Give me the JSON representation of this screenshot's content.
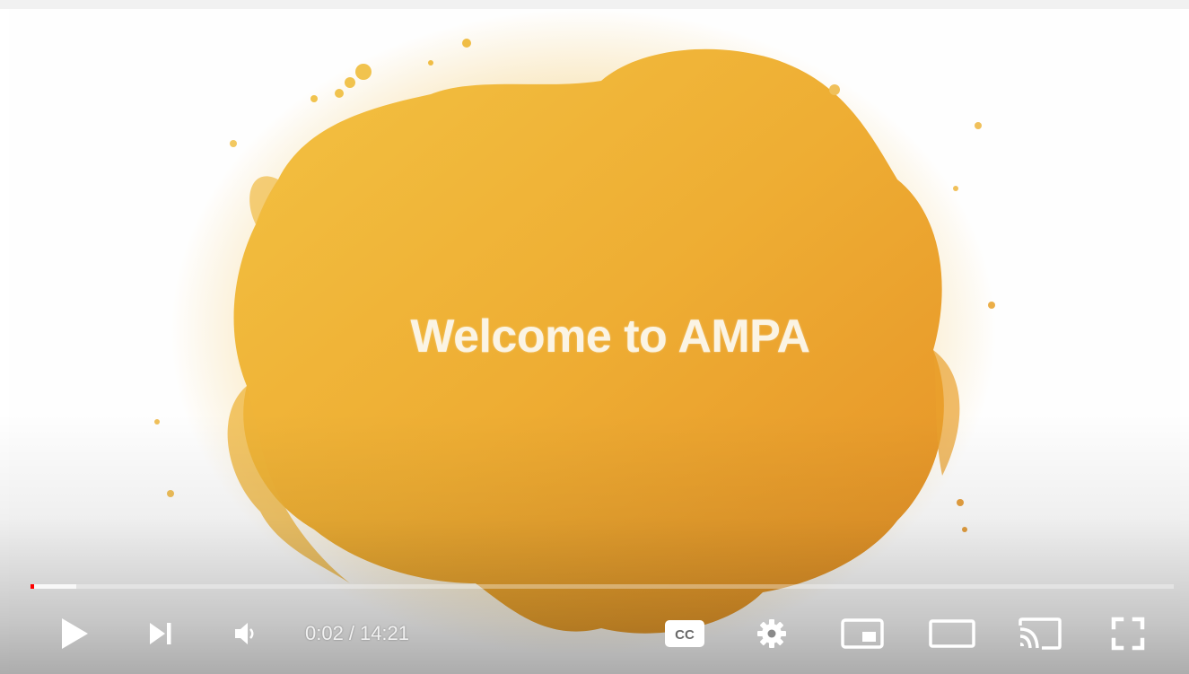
{
  "video": {
    "title_text": "Welcome to AMPA",
    "accent_color": "#e9a132"
  },
  "progress": {
    "played_fraction": 0.0023,
    "buffered_fraction": 0.04,
    "played_color": "#ff0000"
  },
  "time": {
    "current": "0:02",
    "separator": "/",
    "duration": "14:21"
  },
  "controls": {
    "left": [
      "play-icon",
      "next-icon",
      "volume-icon"
    ],
    "right": [
      "captions-icon",
      "settings-icon",
      "miniplayer-icon",
      "theater-mode-icon",
      "cast-icon",
      "fullscreen-icon"
    ],
    "captions_label": "CC"
  }
}
